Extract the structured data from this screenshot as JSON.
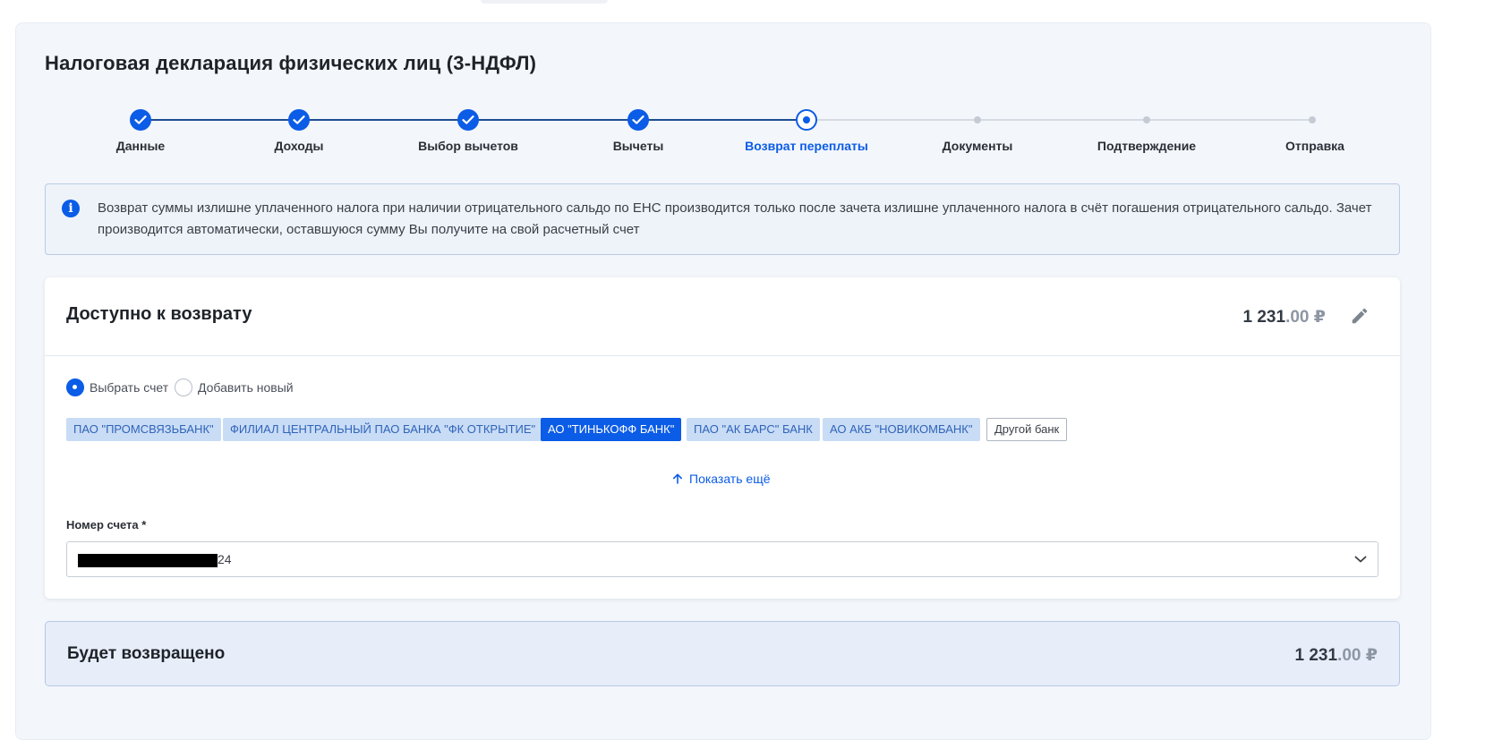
{
  "page": {
    "title": "Налоговая декларация физических лиц (3-НДФЛ)"
  },
  "steps": [
    {
      "label": "Данные",
      "state": "done"
    },
    {
      "label": "Доходы",
      "state": "done"
    },
    {
      "label": "Выбор вычетов",
      "state": "done"
    },
    {
      "label": "Вычеты",
      "state": "done"
    },
    {
      "label": "Возврат переплаты",
      "state": "active"
    },
    {
      "label": "Документы",
      "state": "todo"
    },
    {
      "label": "Подтверждение",
      "state": "todo"
    },
    {
      "label": "Отправка",
      "state": "todo"
    }
  ],
  "info": {
    "icon": "info-icon",
    "text": "Возврат суммы излишне уплаченного налога при наличии отрицательного сальдо по ЕНС производится только после зачета излишне уплаченного налога в счёт погашения отрицательного сальдо. Зачет производится автоматически, оставшуюся сумму Вы получите на свой расчетный счет"
  },
  "refund": {
    "title": "Доступно к возврату",
    "amount_int": "1 231",
    "amount_dec": ".00",
    "currency": "₽",
    "edit_icon": "pencil-icon"
  },
  "account_mode": {
    "options": [
      {
        "label": "Выбрать счет",
        "checked": true
      },
      {
        "label": "Добавить новый",
        "checked": false
      }
    ]
  },
  "banks": [
    {
      "label": "ПАО \"ПРОМСВЯЗЬБАНК\"",
      "selected": false
    },
    {
      "label": "ФИЛИАЛ ЦЕНТРАЛЬНЫЙ ПАО БАНКА \"ФК ОТКРЫТИЕ\"",
      "selected": false
    },
    {
      "label": "АО \"ТИНЬКОФФ БАНК\"",
      "selected": true
    },
    {
      "label": "ПАО \"АК БАРС\" БАНК",
      "selected": false
    },
    {
      "label": "АО АКБ \"НОВИКОМБАНК\"",
      "selected": false
    }
  ],
  "other_bank": "Другой банк",
  "show_more": "Показать ещё",
  "account_field": {
    "label": "Номер счета *",
    "value_suffix": "24"
  },
  "result": {
    "title": "Будет возвращено",
    "amount_int": "1 231",
    "amount_dec": ".00",
    "currency": "₽"
  },
  "colors": {
    "accent": "#0b5ce6",
    "chip_bg": "#c9dcf6",
    "panel_bg": "#f3f6fb"
  }
}
